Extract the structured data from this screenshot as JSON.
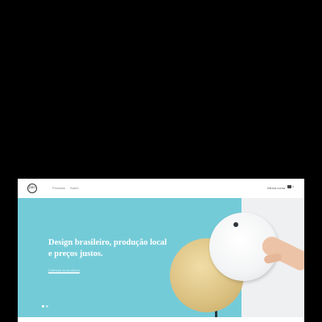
{
  "header": {
    "logo_text": "fulo",
    "nav": [
      {
        "label": "Produtos"
      },
      {
        "label": "Sobre"
      }
    ],
    "account_label": "Minha conta",
    "cart": {
      "icon": "cart-icon",
      "count": "0"
    }
  },
  "hero": {
    "headline_line1": "Design brasileiro, produção local",
    "headline_line2": "e preços justos.",
    "cta_label": "Conheça os produtos",
    "slide_count": 2,
    "active_slide": 1
  },
  "colors": {
    "hero_background": "#74cbd8",
    "page_background": "#000000",
    "gold_disc": "#dcc283",
    "white_disc": "#f3f4f5"
  }
}
